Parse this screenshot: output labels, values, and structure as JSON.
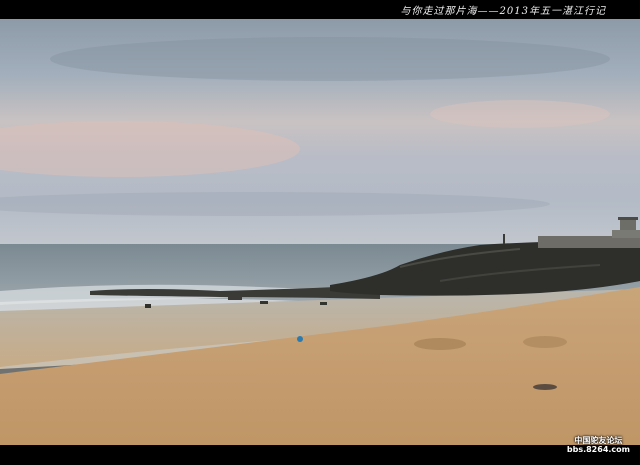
{
  "caption": "与你走过那片海——2013年五一湛江行记",
  "watermark": {
    "line1": "中国驼友论坛",
    "line2": "bbs.8264.com"
  }
}
